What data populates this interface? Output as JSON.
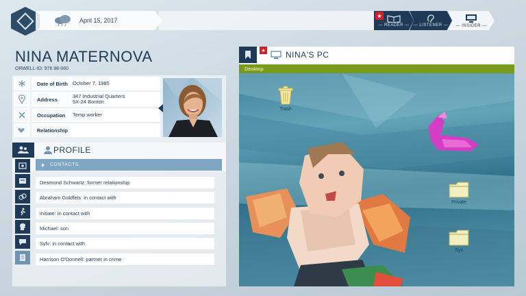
{
  "header": {
    "date": "April 15, 2017",
    "modes": [
      {
        "label": "— READER —"
      },
      {
        "label": "— LISTENER —"
      },
      {
        "label": "— INSIDER —"
      }
    ]
  },
  "person": {
    "name": "NINA MATERNOVA",
    "orwell_id": "ORWELL-ID: 976 98-060"
  },
  "info_rows": [
    {
      "key": "Date of Birth",
      "value": "October 7, 1985"
    },
    {
      "key": "Address",
      "value": "347 Industrial Quarters\n5X-24 Bonton"
    },
    {
      "key": "Occupation",
      "value": "Temp worker"
    },
    {
      "key": "Relationship",
      "value": ""
    }
  ],
  "profile": {
    "title": "PROFILE",
    "contacts_label": "CONTACTS",
    "contacts": [
      "Desmond Schwartz: former relationship",
      "Abraham Goldfels: in contact with",
      "initiate: in contact with",
      "Michael: son",
      "Sylv: in contact with",
      "Harrison O'Donnell: partner in crime"
    ]
  },
  "pc": {
    "title": "NINA'S PC",
    "desktop_label": "Desktop",
    "icons": [
      {
        "label": "Trash"
      },
      {
        "label": "Private"
      },
      {
        "label": "Sys"
      }
    ]
  },
  "colors": {
    "navy": "#1f3a56",
    "desktop_bar": "#7a9a1e",
    "alert_red": "#d0202a",
    "contacts_bar": "#7fa7c4"
  }
}
